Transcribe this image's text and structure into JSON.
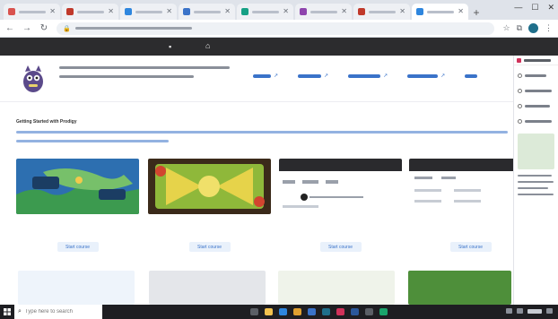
{
  "browser": {
    "tabs": [
      {
        "title": "",
        "favicon_color": "#d9534f",
        "active": false
      },
      {
        "title": "",
        "favicon_color": "#c0392b",
        "active": false
      },
      {
        "title": "",
        "favicon_color": "#2e86de",
        "active": false
      },
      {
        "title": "",
        "favicon_color": "#3a73c9",
        "active": false
      },
      {
        "title": "",
        "favicon_color": "#16a085",
        "active": false
      },
      {
        "title": "",
        "favicon_color": "#8e44ad",
        "active": false
      },
      {
        "title": "",
        "favicon_color": "#c0392b",
        "active": false
      },
      {
        "title": "",
        "favicon_color": "#2e86de",
        "active": false
      },
      {
        "title": "",
        "favicon_color": "#2e86de",
        "active": true
      }
    ],
    "address": "",
    "profile_color": "#1f6f8b"
  },
  "site": {
    "intro_text": "",
    "nav": [
      "",
      "",
      "",
      "",
      ""
    ],
    "section_title": "Getting Started with Prodigy",
    "description": "",
    "cards": [
      {
        "title": "",
        "button": "Start course",
        "thumb_icon": "world-map-thumbnail"
      },
      {
        "title": "",
        "button": "Start course",
        "thumb_icon": "game-arena-thumbnail"
      },
      {
        "title": "",
        "button": "Start course",
        "thumb_icon": "dashboard-thumbnail"
      },
      {
        "title": "",
        "button": "Start course",
        "thumb_icon": "settings-thumbnail"
      }
    ],
    "row2_badge": "",
    "accent_color": "#3a73c9"
  },
  "side_panel": {
    "title": "",
    "items": [
      "",
      "",
      "",
      ""
    ],
    "card_caption": ""
  },
  "taskbar": {
    "search_placeholder": "Type here to search"
  }
}
